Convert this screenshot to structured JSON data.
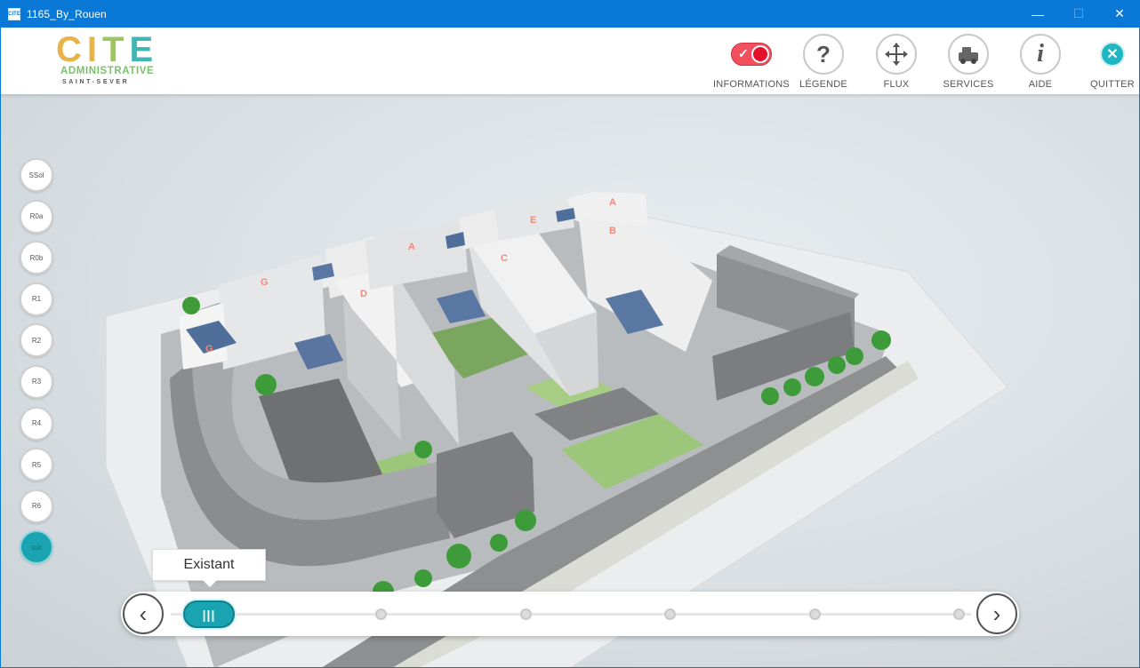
{
  "window": {
    "title": "1165_By_Rouen",
    "app_icon_text": "CITE",
    "controls": {
      "minimize": "—",
      "maximize": "☐",
      "close": "✕"
    }
  },
  "logo": {
    "line1_part1": "CI",
    "line1_part2": "T",
    "line1_part3": "E",
    "line2": "ADMINISTRATIVE",
    "line3": "SAINT-SEVER"
  },
  "toolbar": {
    "informations": {
      "label": "INFORMATIONS",
      "toggle_on": true,
      "check": "✓"
    },
    "legende": {
      "label": "LÉGENDE",
      "icon": "question-icon",
      "glyph": "?"
    },
    "flux": {
      "label": "FLUX",
      "icon": "arrows-move-icon"
    },
    "services": {
      "label": "SERVICES",
      "icon": "services-icon"
    },
    "aide": {
      "label": "AIDE",
      "icon": "info-icon",
      "glyph": "i"
    },
    "quitter": {
      "label": "QUITTER",
      "icon": "close-icon",
      "glyph": "✕"
    }
  },
  "floors": [
    {
      "label": "SSol",
      "active": false
    },
    {
      "label": "R0a",
      "active": false
    },
    {
      "label": "R0b",
      "active": false
    },
    {
      "label": "R1",
      "active": false
    },
    {
      "label": "R2",
      "active": false
    },
    {
      "label": "R3",
      "active": false
    },
    {
      "label": "R4",
      "active": false
    },
    {
      "label": "R5",
      "active": false
    },
    {
      "label": "R6",
      "active": false
    },
    {
      "label": "toit",
      "active": true
    }
  ],
  "building_labels": [
    "G",
    "G",
    "A",
    "D",
    "C",
    "E",
    "A",
    "B"
  ],
  "timeline": {
    "current_label": "Existant",
    "prev": "‹",
    "next": "›",
    "handle_glyph": "|||",
    "step_count": 6,
    "current_step": 0
  },
  "colors": {
    "titlebar": "#0a78d7",
    "accent": "#1aa3b0",
    "toggle": "#e5102a"
  }
}
